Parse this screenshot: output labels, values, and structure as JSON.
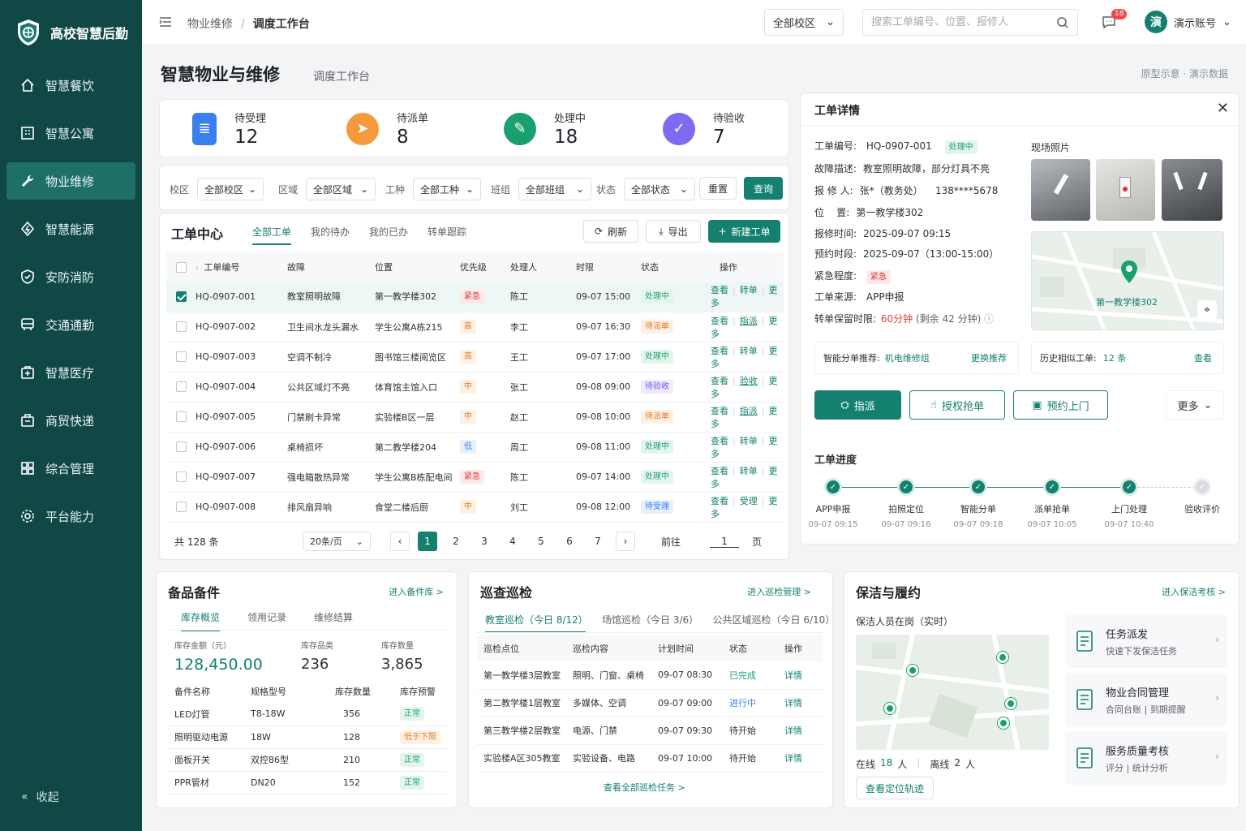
{
  "app": {
    "name": "高校智慧后勤"
  },
  "sidebar": {
    "items": [
      {
        "label": "智慧餐饮",
        "icon": "home-icon"
      },
      {
        "label": "智慧公寓",
        "icon": "building-icon"
      },
      {
        "label": "物业维修",
        "icon": "wrench-icon",
        "active": true
      },
      {
        "label": "智慧能源",
        "icon": "energy-icon"
      },
      {
        "label": "安防消防",
        "icon": "shield-icon"
      },
      {
        "label": "交通通勤",
        "icon": "bus-icon"
      },
      {
        "label": "智慧医疗",
        "icon": "medical-icon"
      },
      {
        "label": "商贸快递",
        "icon": "package-icon"
      },
      {
        "label": "综合管理",
        "icon": "grid-icon"
      },
      {
        "label": "平台能力",
        "icon": "gear-icon"
      }
    ],
    "collapse": "收起"
  },
  "topbar": {
    "breadcrumb": [
      "物业维修",
      "调度工作台"
    ],
    "campus": "全部校区",
    "search_placeholder": "搜索工单编号、位置、报修人",
    "msg_count": "18",
    "avatar": "演",
    "user": "演示账号"
  },
  "page": {
    "title": "智慧物业与维修",
    "subtitle": "调度工作台",
    "hint": "原型示意 · 演示数据"
  },
  "stats": [
    {
      "label": "待受理",
      "value": "12",
      "color": "#3a7ff0"
    },
    {
      "label": "待派单",
      "value": "8",
      "color": "#f59a3c"
    },
    {
      "label": "处理中",
      "value": "18",
      "color": "#1aa06d"
    },
    {
      "label": "待验收",
      "value": "7",
      "color": "#7d6cf0"
    }
  ],
  "filters": {
    "items": [
      {
        "label": "校区",
        "value": "全部校区"
      },
      {
        "label": "区域",
        "value": "全部区域"
      },
      {
        "label": "工种",
        "value": "全部工种"
      },
      {
        "label": "班组",
        "value": "全部班组"
      },
      {
        "label": "状态",
        "value": "全部状态"
      }
    ],
    "reset": "重置",
    "query": "查询"
  },
  "workorders": {
    "title": "工单中心",
    "tabs": [
      "全部工单",
      "我的待办",
      "我的已办",
      "转单跟踪"
    ],
    "refresh": "刷新",
    "export": "导出",
    "create": "新建工单",
    "columns": [
      "工单编号",
      "故障",
      "位置",
      "优先级",
      "处理人",
      "时限",
      "状态",
      "操作"
    ],
    "rows": [
      {
        "id": "HQ-0907-001",
        "fault": "教室照明故障",
        "loc": "第一教学楼302",
        "pri": "紧急",
        "pc": "t-red",
        "who": "陈工",
        "due": "09-07 15:00",
        "status": "处理中",
        "sc": "t-green",
        "ops": [
          "查看",
          "转单",
          "更多"
        ],
        "checked": true
      },
      {
        "id": "HQ-0907-002",
        "fault": "卫生间水龙头漏水",
        "loc": "学生公寓A栋215",
        "pri": "高",
        "pc": "t-orange",
        "who": "李工",
        "due": "09-07 16:30",
        "status": "待派单",
        "sc": "t-orange",
        "ops": [
          "查看",
          "指派",
          "更多"
        ]
      },
      {
        "id": "HQ-0907-003",
        "fault": "空调不制冷",
        "loc": "图书馆三楼阅览区",
        "pri": "高",
        "pc": "t-orange",
        "who": "王工",
        "due": "09-07 17:00",
        "status": "处理中",
        "sc": "t-green",
        "ops": [
          "查看",
          "转单",
          "更多"
        ]
      },
      {
        "id": "HQ-0907-004",
        "fault": "公共区域灯不亮",
        "loc": "体育馆主馆入口",
        "pri": "中",
        "pc": "t-orange",
        "who": "张工",
        "due": "09-08 09:00",
        "status": "待验收",
        "sc": "t-purple",
        "ops": [
          "查看",
          "验收",
          "更多"
        ]
      },
      {
        "id": "HQ-0907-005",
        "fault": "门禁刷卡异常",
        "loc": "实验楼B区一层",
        "pri": "中",
        "pc": "t-orange",
        "who": "赵工",
        "due": "09-08 10:00",
        "status": "待派单",
        "sc": "t-orange",
        "ops": [
          "查看",
          "指派",
          "更多"
        ]
      },
      {
        "id": "HQ-0907-006",
        "fault": "桌椅损坏",
        "loc": "第二教学楼204",
        "pri": "低",
        "pc": "t-blue",
        "who": "周工",
        "due": "09-08 11:00",
        "status": "处理中",
        "sc": "t-green",
        "ops": [
          "查看",
          "转单",
          "更多"
        ]
      },
      {
        "id": "HQ-0907-007",
        "fault": "强电箱散热异常",
        "loc": "学生公寓B栋配电间",
        "pri": "紧急",
        "pc": "t-red",
        "who": "陈工",
        "due": "09-07 14:00",
        "status": "处理中",
        "sc": "t-green",
        "ops": [
          "查看",
          "转单",
          "更多"
        ]
      },
      {
        "id": "HQ-0907-008",
        "fault": "排风扇异响",
        "loc": "食堂二楼后厨",
        "pri": "中",
        "pc": "t-orange",
        "who": "刘工",
        "due": "09-08 12:00",
        "status": "待受理",
        "sc": "t-blue",
        "ops": [
          "查看",
          "受理",
          "更多"
        ]
      }
    ],
    "total": "共 128 条",
    "page_size": "20条/页",
    "pages": [
      "1",
      "2",
      "3",
      "4",
      "5",
      "6",
      "7"
    ],
    "goto_prefix": "前往",
    "goto_value": "1",
    "goto_suffix": "页"
  },
  "detail": {
    "title": "工单详情",
    "no_label": "工单编号:",
    "no": "HQ-0907-001",
    "status": "处理中",
    "rows": [
      {
        "k": "故障描述:",
        "v": "教室照明故障，部分灯具不亮"
      },
      {
        "k": "报 修 人:",
        "v": "张*（教务处）    138****5678"
      },
      {
        "k": "位    置:",
        "v": "第一教学楼302"
      },
      {
        "k": "报修时间:",
        "v": "2025-09-07 09:15"
      },
      {
        "k": "预约时段:",
        "v": "2025-09-07（13:00-15:00）"
      }
    ],
    "urgency_label": "紧急程度:",
    "urgency": "紧急",
    "source_label": "工单来源:",
    "source": "APP申报",
    "sla_label": "转单保留时限:",
    "sla_main": "60分钟",
    "sla_rest": "(剩余 42 分钟)",
    "photos_label": "现场照片",
    "map_label": "第一教学楼302",
    "rec_label": "智能分单推荐:",
    "rec_value": "机电维修组",
    "rec_change": "更换推荐",
    "hist_label": "历史相似工单:",
    "hist_value": "12 条",
    "hist_view": "查看",
    "actions": [
      "指派",
      "授权抢单",
      "预约上门"
    ],
    "more": "更多",
    "progress_title": "工单进度",
    "steps": [
      {
        "name": "APP申报",
        "time": "09-07 09:15",
        "done": true
      },
      {
        "name": "拍照定位",
        "time": "09-07 09:16",
        "done": true
      },
      {
        "name": "智能分单",
        "time": "09-07 09:18",
        "done": true
      },
      {
        "name": "派单抢单",
        "time": "09-07 10:05",
        "done": true
      },
      {
        "name": "上门处理",
        "time": "09-07 10:40",
        "done": true
      },
      {
        "name": "验收评价",
        "time": "",
        "done": false
      }
    ]
  },
  "spare": {
    "title": "备品备件",
    "link": "进入备件库 >",
    "tabs": [
      "库存概览",
      "领用记录",
      "维修结算"
    ],
    "kpis": [
      {
        "label": "库存金额（元）",
        "value": "128,450.00"
      },
      {
        "label": "库存品类",
        "value": "236"
      },
      {
        "label": "库存数量",
        "value": "3,865"
      }
    ],
    "columns": [
      "备件名称",
      "规格型号",
      "库存数量",
      "库存预警"
    ],
    "rows": [
      {
        "name": "LED灯管",
        "spec": "T8-18W",
        "qty": "356",
        "warn": "正常",
        "wc": "t-green"
      },
      {
        "name": "照明驱动电源",
        "spec": "18W",
        "qty": "128",
        "warn": "低于下限",
        "wc": "t-orange"
      },
      {
        "name": "面板开关",
        "spec": "双控86型",
        "qty": "210",
        "warn": "正常",
        "wc": "t-green"
      },
      {
        "name": "PPR管材",
        "spec": "DN20",
        "qty": "152",
        "warn": "正常",
        "wc": "t-green"
      }
    ]
  },
  "patrol": {
    "title": "巡查巡检",
    "link": "进入巡检管理 >",
    "tabs": [
      "教室巡检（今日 8/12）",
      "场馆巡检（今日 3/6）",
      "公共区域巡检（今日 6/10）"
    ],
    "columns": [
      "巡检点位",
      "巡检内容",
      "计划时间",
      "状态",
      "操作"
    ],
    "rows": [
      {
        "point": "第一教学楼3层教室",
        "content": "照明、门窗、桌椅",
        "time": "09-07 08:30",
        "status": "已完成",
        "color": "#1fa36c",
        "op": "详情"
      },
      {
        "point": "第二教学楼1层教室",
        "content": "多媒体、空调",
        "time": "09-07 09:00",
        "status": "进行中",
        "color": "#3a7ff0",
        "op": "详情"
      },
      {
        "point": "第三教学楼2层教室",
        "content": "电源、门禁",
        "time": "09-07 09:30",
        "status": "待开始",
        "color": "#303133",
        "op": "详情"
      },
      {
        "point": "实验楼A区305教室",
        "content": "实验设备、电路",
        "time": "09-07 10:00",
        "status": "待开始",
        "color": "#303133",
        "op": "详情"
      }
    ],
    "view_all": "查看全部巡检任务 >"
  },
  "clean": {
    "title": "保洁与履约",
    "link": "进入保洁考核 >",
    "map_title": "保洁人员在岗（实时）",
    "online_label": "在线",
    "online": "18",
    "offline_label": "离线",
    "offline": "2",
    "unit": "人",
    "track": "查看定位轨迹",
    "cards": [
      {
        "t1": "任务派发",
        "t2": "快速下发保洁任务"
      },
      {
        "t1": "物业合同管理",
        "t2": "合同台账 | 到期提醒"
      },
      {
        "t1": "服务质量考核",
        "t2": "评分 | 统计分析"
      }
    ]
  }
}
